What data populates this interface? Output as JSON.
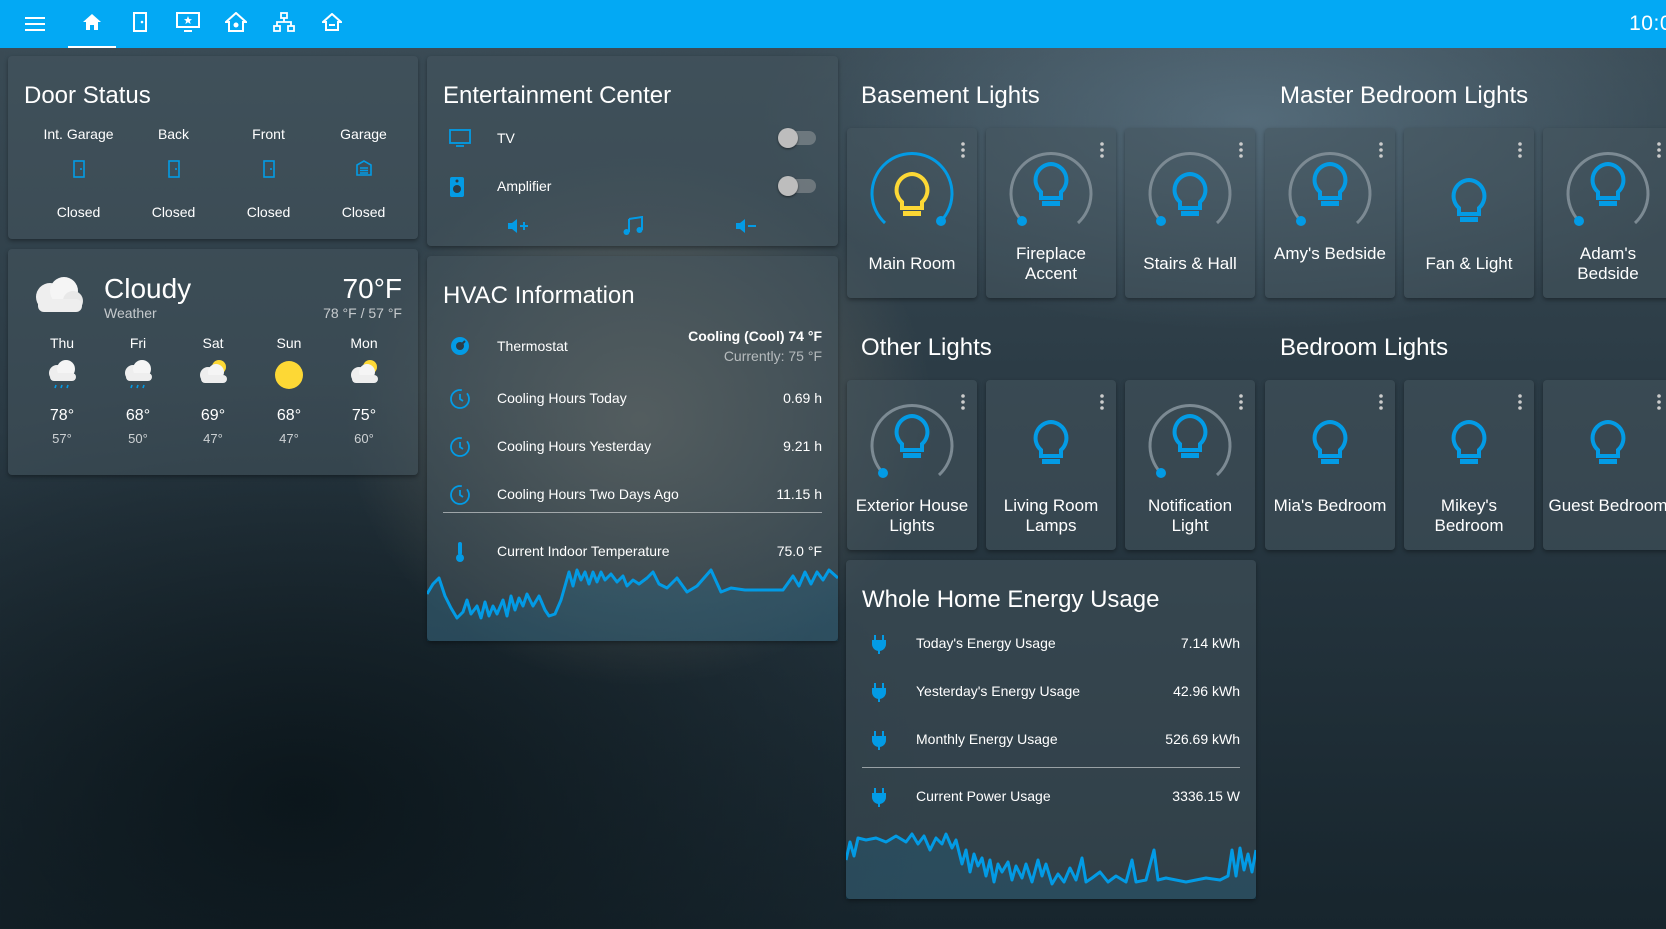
{
  "topbar": {
    "clock": "10:0",
    "menu_icon": "menu-icon",
    "tabs": [
      {
        "icon": "home-icon",
        "active": true
      },
      {
        "icon": "door-icon",
        "active": false
      },
      {
        "icon": "monitor-star-icon",
        "active": false
      },
      {
        "icon": "home-group-icon",
        "active": false
      },
      {
        "icon": "network-icon",
        "active": false
      },
      {
        "icon": "home-outline-icon",
        "active": false
      }
    ]
  },
  "door_status": {
    "title": "Door Status",
    "doors": [
      {
        "label": "Int. Garage",
        "state": "Closed",
        "icon": "door-closed-icon"
      },
      {
        "label": "Back",
        "state": "Closed",
        "icon": "door-closed-icon"
      },
      {
        "label": "Front",
        "state": "Closed",
        "icon": "door-closed-icon"
      },
      {
        "label": "Garage",
        "state": "Closed",
        "icon": "garage-icon"
      }
    ]
  },
  "weather": {
    "condition": "Cloudy",
    "subtitle": "Weather",
    "temp": "70°F",
    "hilo": "78 °F / 57 °F",
    "forecast": [
      {
        "day": "Thu",
        "hi": "78°",
        "lo": "57°",
        "icon": "rainy-icon"
      },
      {
        "day": "Fri",
        "hi": "68°",
        "lo": "50°",
        "icon": "rainy-icon"
      },
      {
        "day": "Sat",
        "hi": "69°",
        "lo": "47°",
        "icon": "partly-cloudy-icon"
      },
      {
        "day": "Sun",
        "hi": "68°",
        "lo": "47°",
        "icon": "sunny-icon"
      },
      {
        "day": "Mon",
        "hi": "75°",
        "lo": "60°",
        "icon": "partly-cloudy-icon"
      }
    ]
  },
  "entertainment": {
    "title": "Entertainment Center",
    "items": [
      {
        "name": "TV",
        "on": false,
        "icon": "television-icon"
      },
      {
        "name": "Amplifier",
        "on": false,
        "icon": "speaker-icon"
      }
    ],
    "controls": [
      "volume-up-icon",
      "music-note-icon",
      "volume-down-icon"
    ]
  },
  "hvac": {
    "title": "HVAC Information",
    "thermostat": {
      "name": "Thermostat",
      "state": "Cooling (Cool) 74 °F",
      "current": "Currently: 75 °F"
    },
    "rows": [
      {
        "name": "Cooling Hours Today",
        "value": "0.69 h"
      },
      {
        "name": "Cooling Hours Yesterday",
        "value": "9.21 h"
      },
      {
        "name": "Cooling Hours Two Days Ago",
        "value": "11.15 h"
      }
    ],
    "indoor": {
      "name": "Current Indoor Temperature",
      "value": "75.0 °F"
    }
  },
  "basement_lights": {
    "title": "Basement Lights",
    "lights": [
      {
        "name": "Main Room",
        "on": true,
        "level": 0.6
      },
      {
        "name": "Fireplace Accent",
        "on": false,
        "level": 0
      },
      {
        "name": "Stairs & Hall",
        "on": false,
        "level": 0
      }
    ]
  },
  "master_lights": {
    "title": "Master Bedroom Lights",
    "lights": [
      {
        "name": "Amy's Bedside",
        "on": false,
        "level": 0
      },
      {
        "name": "Fan & Light",
        "on": false,
        "level": null
      },
      {
        "name": "Adam's Bedside",
        "on": false,
        "level": 0
      }
    ]
  },
  "other_lights": {
    "title": "Other Lights",
    "lights": [
      {
        "name": "Exterior House Lights",
        "on": false,
        "level": 0
      },
      {
        "name": "Living Room Lamps",
        "on": false,
        "level": null
      },
      {
        "name": "Notification Light",
        "on": false,
        "level": 0
      }
    ]
  },
  "bedroom_lights": {
    "title": "Bedroom Lights",
    "lights": [
      {
        "name": "Mia's Bedroom",
        "on": false,
        "level": null
      },
      {
        "name": "Mikey's Bedroom",
        "on": false,
        "level": null
      },
      {
        "name": "Guest Bedroom",
        "on": false,
        "level": null
      }
    ]
  },
  "energy": {
    "title": "Whole Home Energy Usage",
    "rows": [
      {
        "name": "Today's Energy Usage",
        "value": "7.14 kWh"
      },
      {
        "name": "Yesterday's Energy Usage",
        "value": "42.96 kWh"
      },
      {
        "name": "Monthly Energy Usage",
        "value": "526.69 kWh"
      }
    ],
    "power": {
      "name": "Current Power Usage",
      "value": "3336.15 W"
    }
  },
  "colors": {
    "accent": "#03a9f4",
    "light_on": "#fdd835",
    "icon_blue": "#039be5",
    "ring_off": "#7c8a93"
  }
}
